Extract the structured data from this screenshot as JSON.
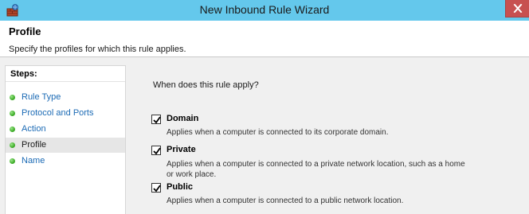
{
  "window": {
    "title": "New Inbound Rule Wizard"
  },
  "header": {
    "title": "Profile",
    "description": "Specify the profiles for which this rule applies."
  },
  "steps": {
    "heading": "Steps:",
    "items": [
      {
        "label": "Rule Type",
        "selected": false
      },
      {
        "label": "Protocol and Ports",
        "selected": false
      },
      {
        "label": "Action",
        "selected": false
      },
      {
        "label": "Profile",
        "selected": true
      },
      {
        "label": "Name",
        "selected": false
      }
    ]
  },
  "main": {
    "question": "When does this rule apply?",
    "options": [
      {
        "label": "Domain",
        "checked": true,
        "description": "Applies when a computer is connected to its corporate domain."
      },
      {
        "label": "Private",
        "checked": true,
        "description_line1": "Applies when a computer is connected to a private network location, such as a home",
        "description_line2": "or work place."
      },
      {
        "label": "Public",
        "checked": true,
        "description": "Applies when a computer is connected to a public network location."
      }
    ]
  },
  "colors": {
    "titlebar": "#64c8ec",
    "close_button": "#c75050",
    "link": "#1c6bb5",
    "step_dot": "#3fae2a"
  },
  "icons": {
    "app": "firewall-wizard-icon",
    "close": "close-icon",
    "step": "green-dot-icon",
    "check": "checkmark-icon"
  }
}
